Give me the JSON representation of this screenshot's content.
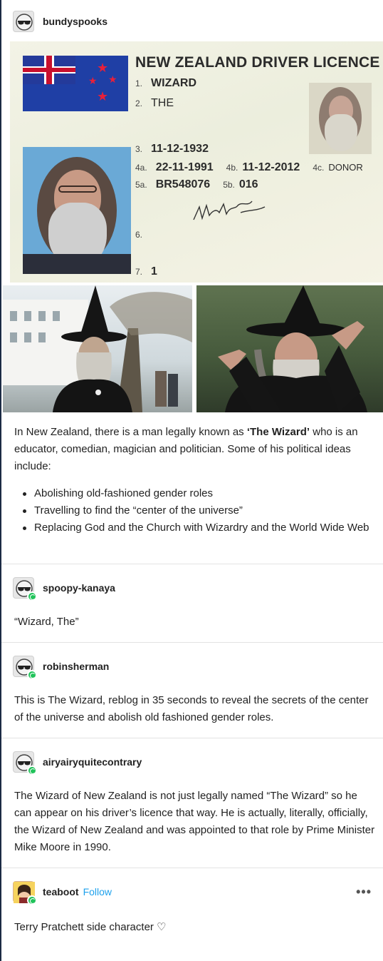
{
  "original_post": {
    "username": "bundyspooks",
    "licence": {
      "title": "NEW ZEALAND DRIVER LICENCE",
      "field1_num": "1.",
      "field1": "WIZARD",
      "field2_num": "2.",
      "field2": "THE",
      "field3_num": "3.",
      "field3": "11-12-1932",
      "field4a_num": "4a.",
      "field4a": "22-11-1991",
      "field4b_num": "4b.",
      "field4b": "11-12-2012",
      "field4c_num": "4c.",
      "field4c": "DONOR",
      "field5a_num": "5a.",
      "field5a": "BR548076",
      "field5b_num": "5b.",
      "field5b": "016",
      "field6_num": "6.",
      "field7_num": "7.",
      "field7": "1"
    },
    "body_intro_pre": "In New Zealand, there is a man legally known as ",
    "body_intro_bold": "‘The Wizard’",
    "body_intro_post": " who is an educator, comedian, magician and politician. Some of his political ideas include:",
    "bullets": [
      "Abolishing old-fashioned gender roles",
      "Travelling to find the “center of the universe”",
      "Replacing God and the Church with Wizardry and the World Wide Web"
    ]
  },
  "reblogs": [
    {
      "username": "spoopy-kanaya",
      "text": "“Wizard, The”"
    },
    {
      "username": "robinsherman",
      "text": "This is The Wizard, reblog in 35 seconds to reveal the secrets of the center of the universe and abolish old fashioned gender roles."
    },
    {
      "username": "airyairyquitecontrary",
      "text": "The Wizard of New Zealand is not just legally named “The Wizard” so he can appear on his driver’s licence that way.  He is actually, literally, officially, the Wizard of New Zealand and was appointed to that role by Prime Minister Mike Moore in 1990."
    },
    {
      "username": "teaboot",
      "follow_label": "Follow",
      "more_label": "•••",
      "text": "Terry Pratchett side character ♡"
    }
  ],
  "colors": {
    "follow": "#1ea1ec",
    "reblog_badge": "#21c35a",
    "border": "#1b2a44"
  }
}
